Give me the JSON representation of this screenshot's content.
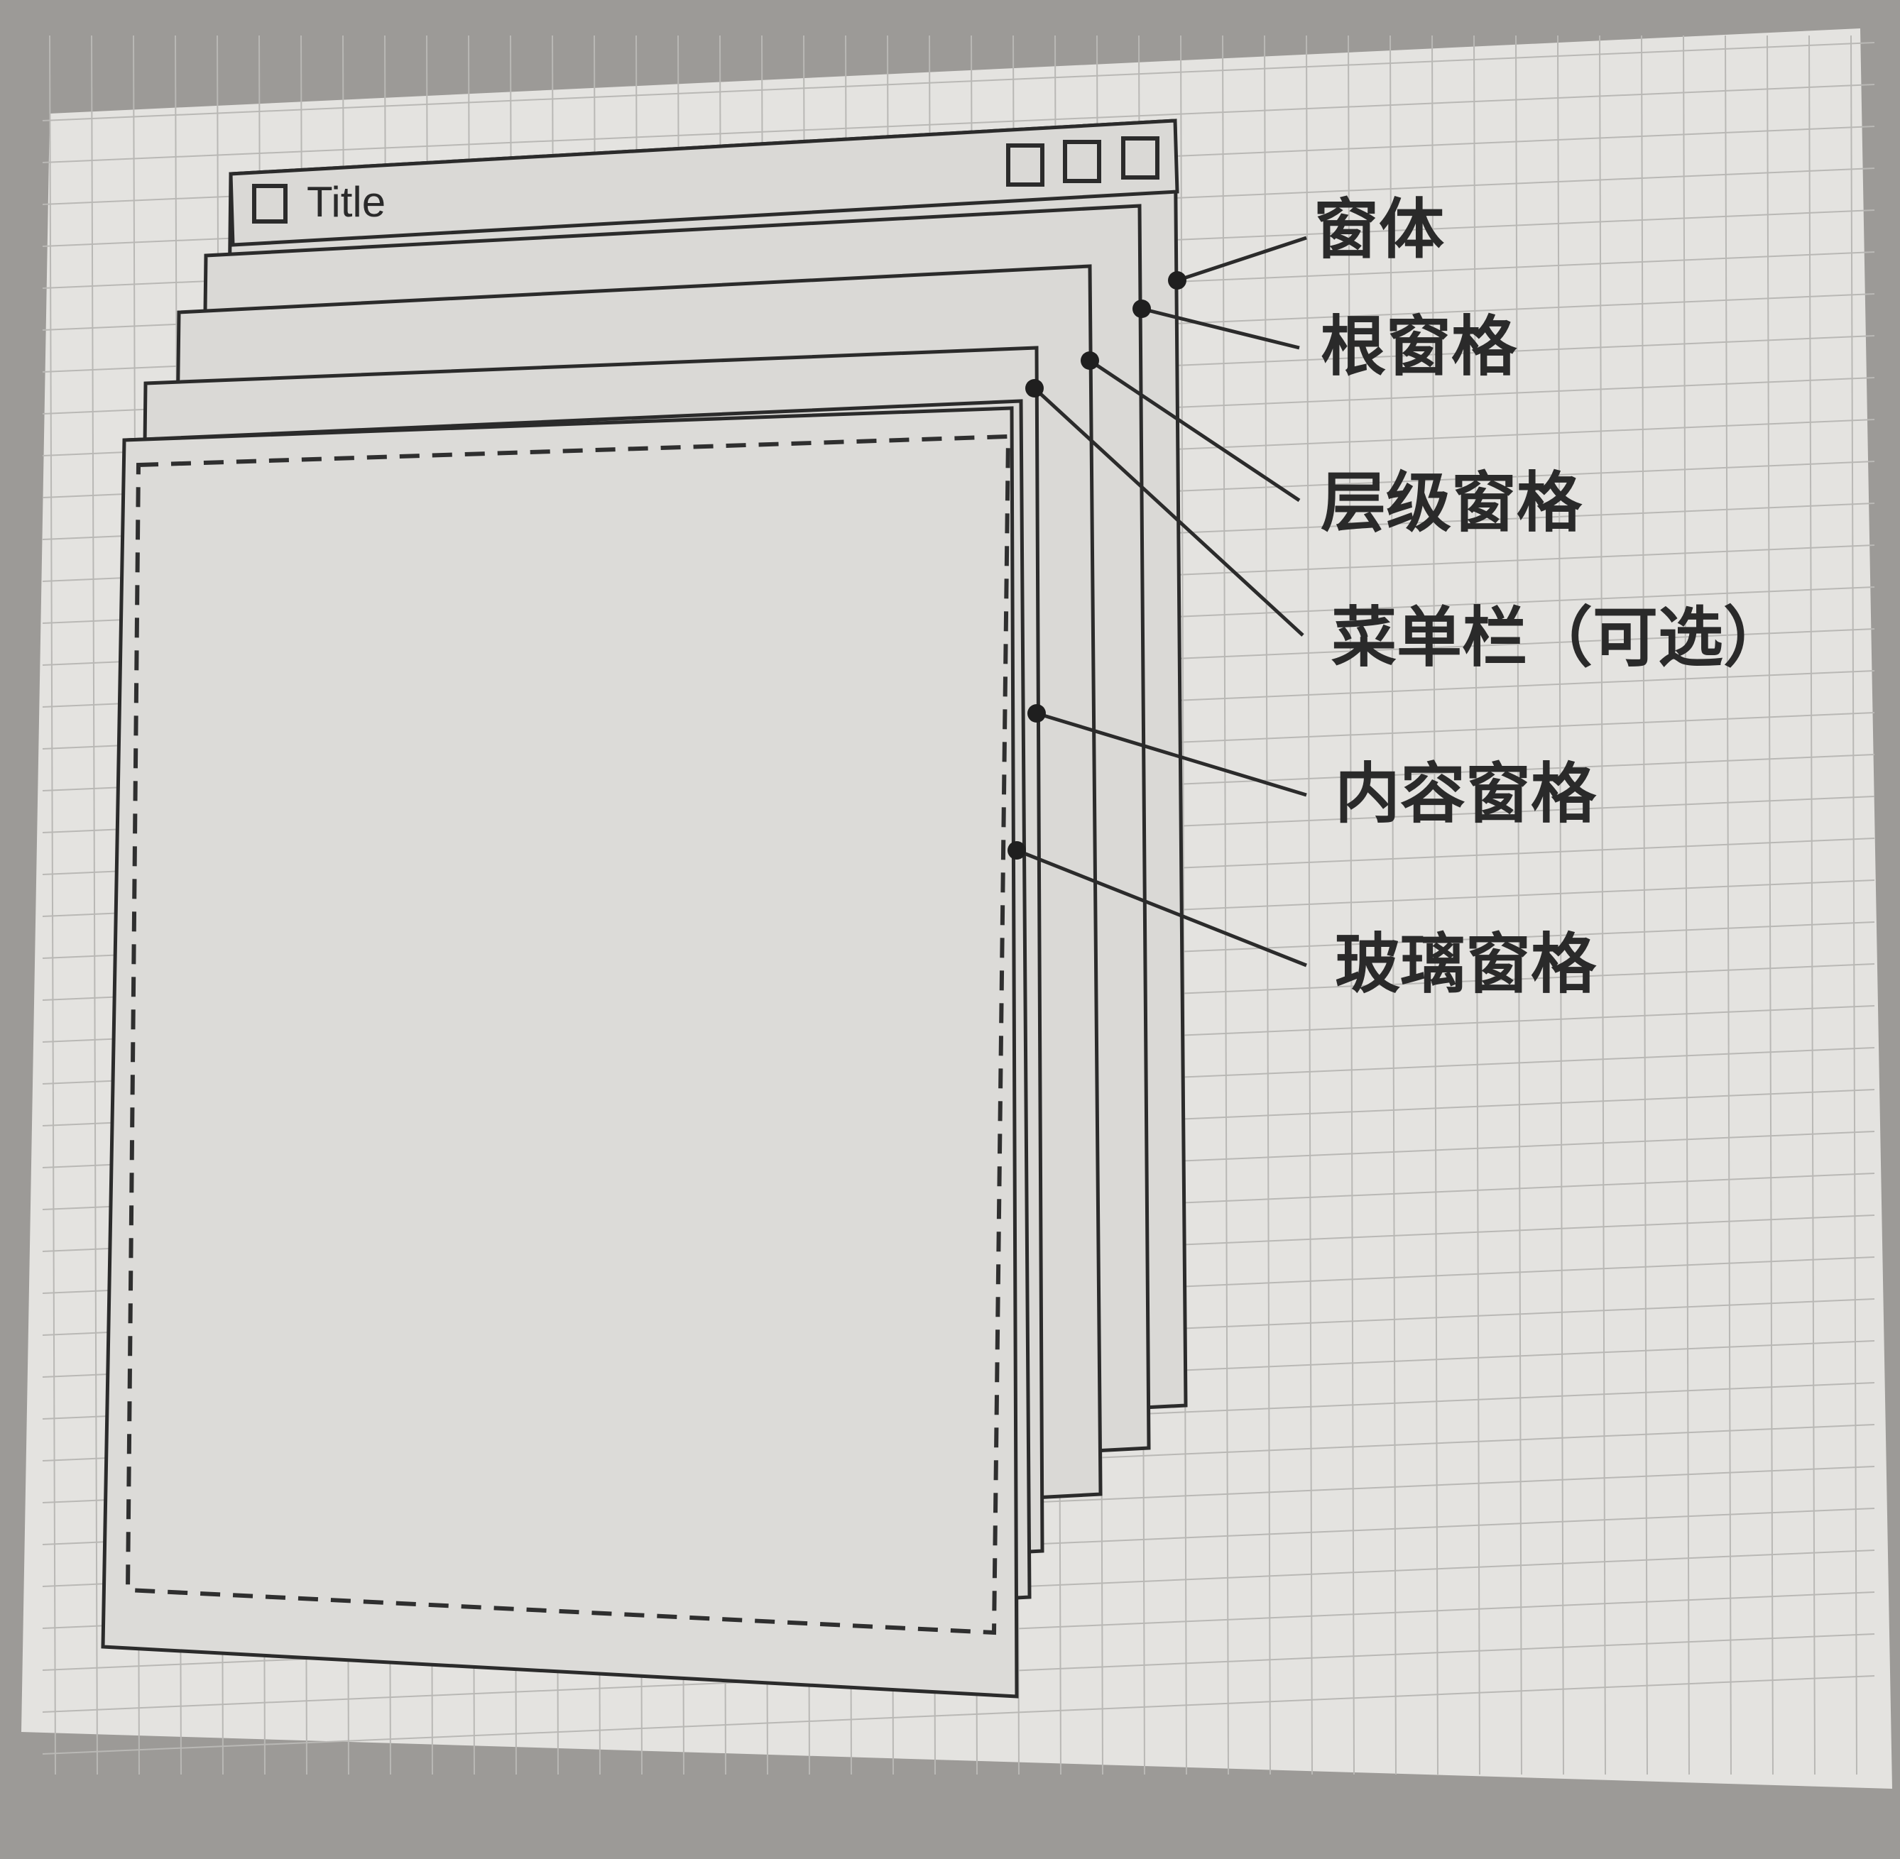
{
  "window": {
    "title": "Title"
  },
  "labels": {
    "frame": "窗体",
    "root_pane": "根窗格",
    "layered_pane": "层级窗格",
    "menu_bar": "菜单栏（可选）",
    "content_pane": "内容窗格",
    "glass_pane": "玻璃窗格"
  },
  "colors": {
    "paper": "#e4e3e0",
    "grid": "#b9b8b5",
    "ink": "#2b2b2b",
    "pane_fill": "#dad9d6"
  }
}
